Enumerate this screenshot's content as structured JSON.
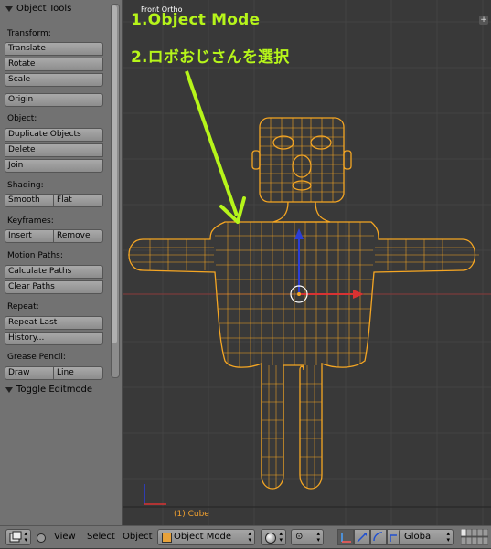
{
  "toolshelf": {
    "title": "Object Tools",
    "transform": {
      "label": "Transform:",
      "translate": "Translate",
      "rotate": "Rotate",
      "scale": "Scale",
      "origin": "Origin"
    },
    "object": {
      "label": "Object:",
      "duplicate": "Duplicate Objects",
      "delete": "Delete",
      "join": "Join"
    },
    "shading": {
      "label": "Shading:",
      "smooth": "Smooth",
      "flat": "Flat"
    },
    "keyframes": {
      "label": "Keyframes:",
      "insert": "Insert",
      "remove": "Remove"
    },
    "motion_paths": {
      "label": "Motion Paths:",
      "calculate": "Calculate Paths",
      "clear": "Clear Paths"
    },
    "repeat": {
      "label": "Repeat:",
      "repeat_last": "Repeat Last",
      "history": "History..."
    },
    "grease_pencil": {
      "label": "Grease Pencil:",
      "draw": "Draw",
      "line": "Line"
    },
    "toggle_editmode": "Toggle Editmode"
  },
  "viewport": {
    "view_name": "Front Ortho",
    "object_label": "(1) Cube",
    "annotations": [
      "1.Object Mode",
      "2.ロボおじさんを選択"
    ],
    "wire_color": "#f5a623",
    "annotation_color": "#b6f51a"
  },
  "header": {
    "menu": {
      "view": "View",
      "select": "Select",
      "object": "Object"
    },
    "mode": "Object Mode",
    "orientation": "Global"
  }
}
